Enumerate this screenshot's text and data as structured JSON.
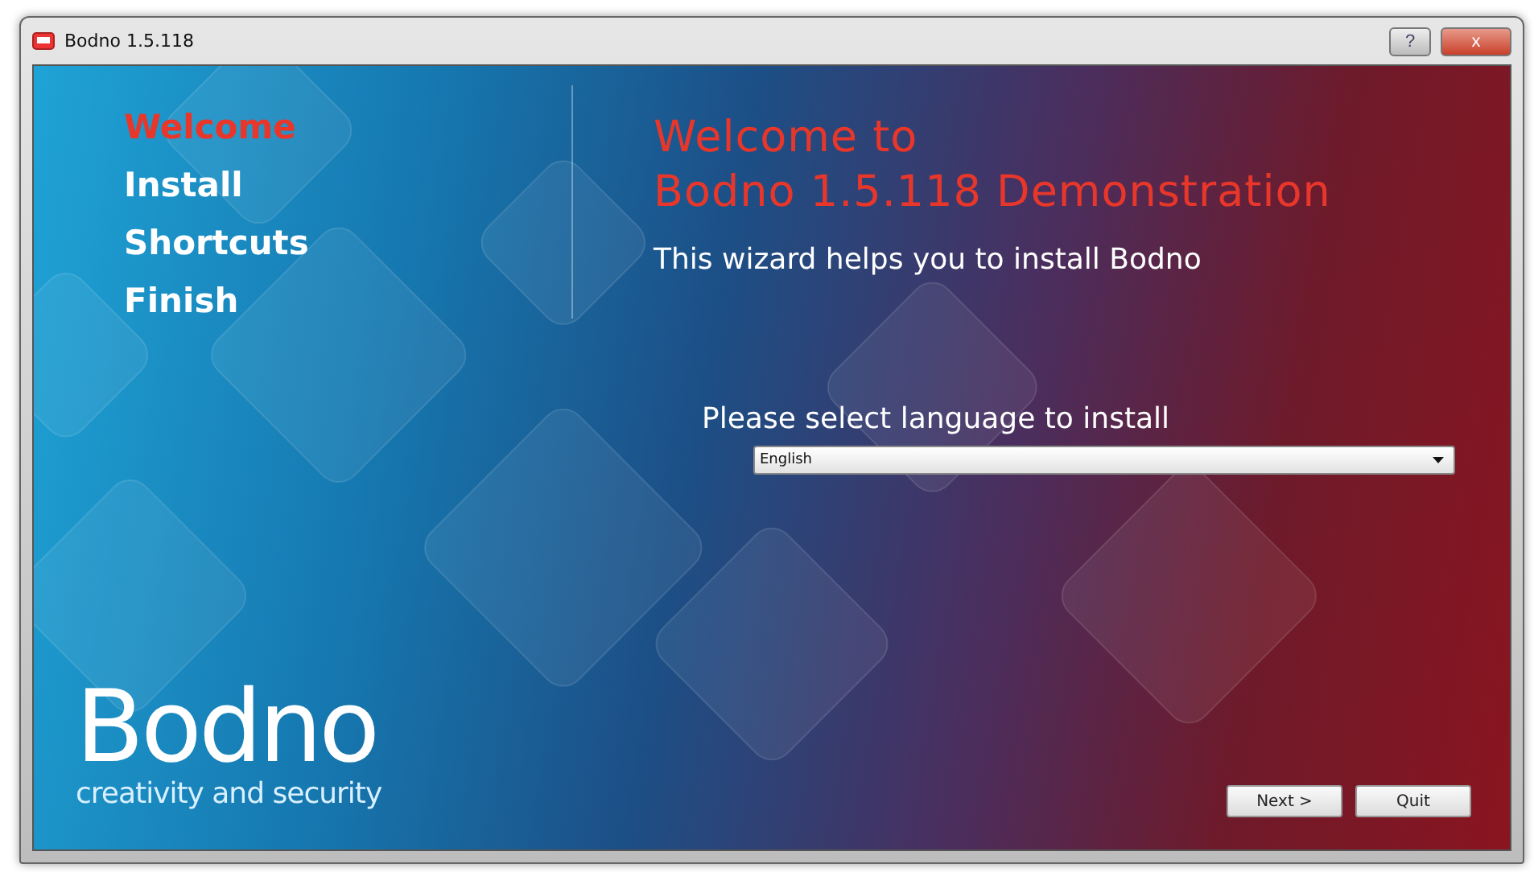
{
  "window": {
    "title": "Bodno 1.5.118",
    "buttons": [
      {
        "kind": "help",
        "label": "?"
      },
      {
        "kind": "close",
        "label": "x"
      }
    ]
  },
  "steps": [
    {
      "label": "Welcome",
      "selected": true
    },
    {
      "label": "Install",
      "selected": false
    },
    {
      "label": "Shortcuts",
      "selected": false
    },
    {
      "label": "Finish",
      "selected": false
    }
  ],
  "heading": [
    "Welcome to",
    "Bodno 1.5.118 Demonstration"
  ],
  "subtitle": "This wizard helps you to install Bodno",
  "language": {
    "label": "Please select language to install",
    "value": "English"
  },
  "logo": {
    "name": "Bodno",
    "tagline": "creativity and security"
  },
  "actions": [
    "Next >",
    "Quit"
  ]
}
